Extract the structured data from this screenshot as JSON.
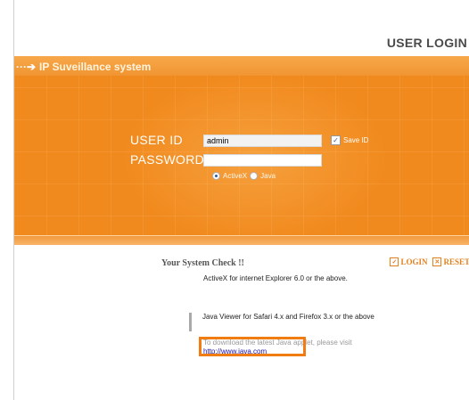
{
  "header": {
    "title": "USER LOGIN"
  },
  "banner": {
    "brand": "IP Suveillance system"
  },
  "form": {
    "user_label": "USER ID",
    "user_value": "admin",
    "password_label": "PASSWORD",
    "password_value": "",
    "save_id_label": "Save ID",
    "save_id_checked": true,
    "viewer_options": [
      {
        "label": "ActiveX",
        "selected": true
      },
      {
        "label": "Java",
        "selected": false
      }
    ]
  },
  "actions": {
    "login_label": "LOGIN",
    "reset_label": "RESET"
  },
  "system_check": {
    "title": "Your System Check !!",
    "activex_note": "ActiveX for internet Explorer 6.0 or the above.",
    "java_note": "Java Viewer for Safari 4.x and Firefox 3.x or the above",
    "download_note": "To download the latest Java applet, please visit",
    "java_link": "http://www.java.com"
  },
  "colors": {
    "banner": "#f18a1e",
    "accent": "#e2801e",
    "highlight": "#f07c12"
  }
}
